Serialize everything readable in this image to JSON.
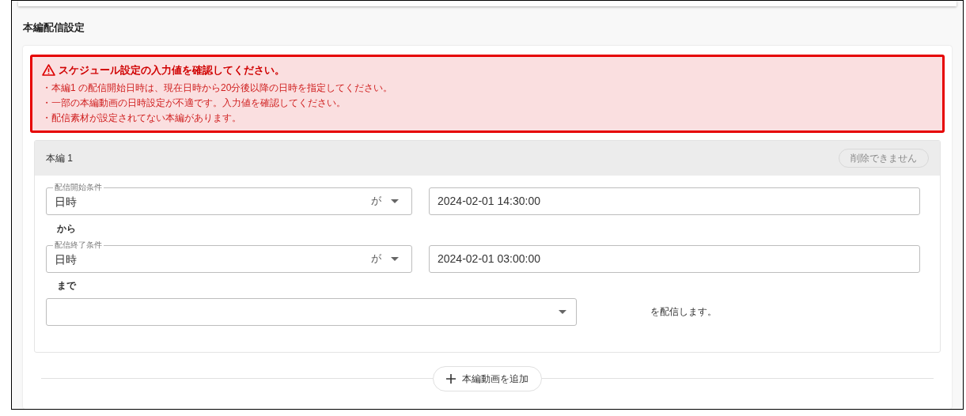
{
  "section_title": "本編配信設定",
  "alert": {
    "title": "スケジュール設定の入力値を確認してください。",
    "messages": [
      "・本編1 の配信開始日時は、現在日時から20分後以降の日時を指定してください。",
      "・一部の本編動画の日時設定が不適です。入力値を確認してください。",
      "・配信素材が設定されてない本編があります。"
    ]
  },
  "episodes": [
    {
      "title": "本編 1",
      "delete_button": {
        "label": "削除できません",
        "disabled": true
      },
      "start": {
        "label": "配信開始条件",
        "value": "日時",
        "suffix": "が",
        "datetime": "2024-02-01 14:30:00"
      },
      "from_label": "から",
      "end": {
        "label": "配信終了条件",
        "value": "日時",
        "suffix": "が",
        "datetime": "2024-02-01 03:00:00"
      },
      "until_label": "まで",
      "material_suffix": "を配信します。"
    }
  ],
  "add_button": {
    "label": "本編動画を追加"
  }
}
